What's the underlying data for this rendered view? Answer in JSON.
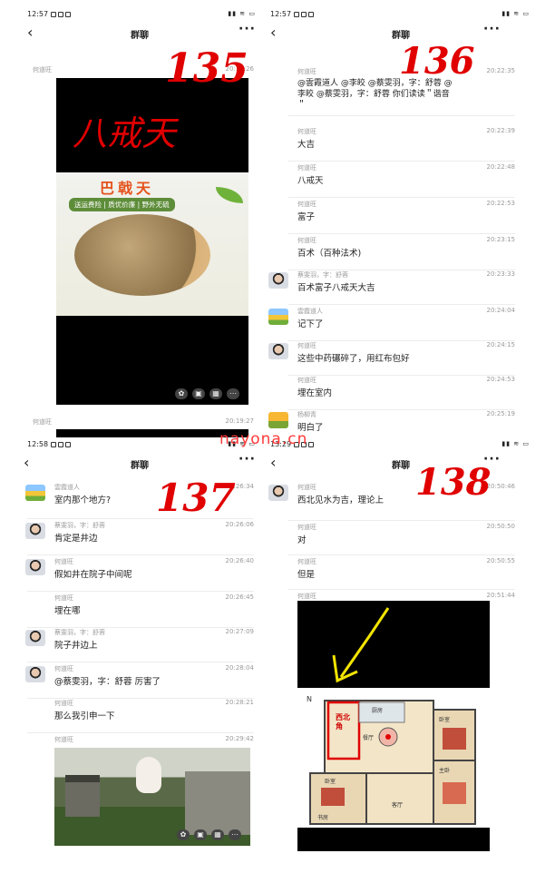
{
  "panels": [
    {
      "time": "12:57",
      "nav": {
        "title": "群聊",
        "back": "‹",
        "more": "···"
      },
      "handwritten": "135",
      "messages": [
        {
          "name": "何道旺",
          "ts": "20:19:26"
        }
      ],
      "image_texts": {
        "overlay": "八戒天",
        "product_title": "巴戟天",
        "product_sub": "送运费险 | 质优价廉 | 野外无硫"
      },
      "next_name": "何道旺",
      "next_ts": "20:19:27"
    },
    {
      "time": "12:57",
      "nav": {
        "title": "群聊",
        "back": "‹",
        "more": "···"
      },
      "handwritten": "136",
      "messages": [
        {
          "name": "何道旺",
          "ts": "20:22:35",
          "line1": "@雲霞道人 @李皎 @蔡雯羽，字：舒蓉 @",
          "line2": "李皎 @蔡雯羽，字：舒蓉 你们读读＂谐音",
          "line3": "＂"
        },
        {
          "name": "何道旺",
          "ts": "20:22:39",
          "text": "大吉"
        },
        {
          "name": "何道旺",
          "ts": "20:22:48",
          "text": "八戒天"
        },
        {
          "name": "何道旺",
          "ts": "20:22:53",
          "text": "富子"
        },
        {
          "name": "何道旺",
          "ts": "20:23:15",
          "text": "百术（百种法术)"
        },
        {
          "name": "蔡雯羽，字：舒蓉",
          "ts": "20:23:33",
          "text": "百术富子八戒天大吉"
        },
        {
          "name": "雲霞道人",
          "ts": "20:24:04",
          "text": "记下了"
        },
        {
          "name": "何道旺",
          "ts": "20:24:15",
          "text": "这些中药碾碎了，用红布包好"
        },
        {
          "name": "何道旺",
          "ts": "20:24:53",
          "text": "埋在室内"
        },
        {
          "name": "杨柳青",
          "ts": "20:25:19",
          "text": "明白了"
        }
      ]
    },
    {
      "time": "12:58",
      "nav": {
        "title": "群聊",
        "back": "‹",
        "more": "···"
      },
      "handwritten": "137",
      "messages": [
        {
          "name": "雲霞道人",
          "ts": "20:26:34",
          "text": "室内那个地方?"
        },
        {
          "name": "蔡雯羽，字：舒蓉",
          "ts": "20:26:06",
          "text": "肯定是井边"
        },
        {
          "name": "何道旺",
          "ts": "20:26:40",
          "text": "假如井在院子中间呢"
        },
        {
          "name": "何道旺",
          "ts": "20:26:45",
          "text": "埋在哪"
        },
        {
          "name": "蔡雯羽，字：舒蓉",
          "ts": "20:27:09",
          "text": "院子井边上"
        },
        {
          "name": "何道旺",
          "ts": "20:28:04",
          "text": "@蔡雯羽，字：舒蓉 厉害了"
        },
        {
          "name": "何道旺",
          "ts": "20:28:21",
          "text": "那么我引申一下"
        },
        {
          "name": "何道旺",
          "ts": "20:29:42"
        }
      ]
    },
    {
      "time": "13:29",
      "nav": {
        "title": "群聊",
        "back": "‹",
        "more": "···"
      },
      "handwritten": "138",
      "messages": [
        {
          "name": "何道旺",
          "ts": "20:50:46",
          "text": "西北见水为吉，理论上"
        },
        {
          "name": "何道旺",
          "ts": "20:50:50",
          "text": "对"
        },
        {
          "name": "何道旺",
          "ts": "20:50:55",
          "text": "但是"
        },
        {
          "name": "何道旺",
          "ts": "20:51:44"
        }
      ],
      "plan": {
        "north": "N",
        "rooms": [
          "厨房",
          "餐厅",
          "卧室",
          "主卧",
          "客厅",
          "卧室",
          "书房"
        ],
        "label": "西北角"
      }
    }
  ],
  "watermark": "nayona.cn",
  "photo_bar_icons": [
    "flower-icon",
    "download-icon",
    "grid-icon",
    "more-icon"
  ]
}
